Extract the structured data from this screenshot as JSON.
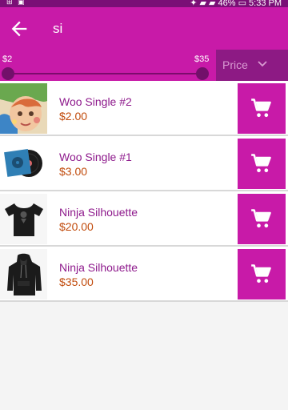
{
  "status_bar": {
    "left_icons": "⊞ ▣",
    "right_text": "✦ ▰ ▰ 46% ▭ 5:33 PM"
  },
  "search": {
    "query": "si"
  },
  "filter": {
    "price_min_label": "$2",
    "price_max_label": "$35",
    "slider_min_fraction": 0.0,
    "slider_max_fraction": 1.0,
    "sort_label": "Price"
  },
  "colors": {
    "primary": "#c81aa8",
    "product_name": "#8e1a8c",
    "price": "#c14b0c"
  },
  "products": [
    {
      "name": "Woo Single #2",
      "price": "$2.00",
      "icon": "painted-child-photo"
    },
    {
      "name": "Woo Single #1",
      "price": "$3.00",
      "icon": "vinyl-record"
    },
    {
      "name": "Ninja Silhouette",
      "price": "$20.00",
      "icon": "black-tshirt"
    },
    {
      "name": "Ninja Silhouette",
      "price": "$35.00",
      "icon": "black-hoodie"
    }
  ],
  "cart_icon": "shopping-cart-icon"
}
